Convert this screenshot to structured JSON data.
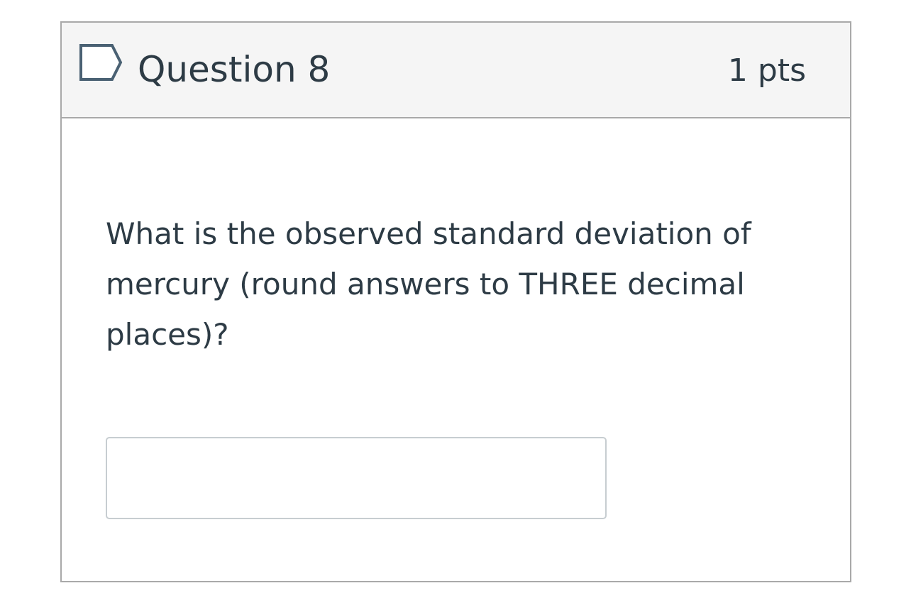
{
  "question": {
    "title": "Question 8",
    "points": "1 pts",
    "prompt": "What is the observed standard deviation of mercury (round answers to THREE decimal places)?",
    "answer": {
      "value": "",
      "placeholder": ""
    }
  },
  "icons": {
    "flag": "flag-question-icon"
  },
  "colors": {
    "header_background": "#f5f5f5",
    "border": "#a9a9a9",
    "text": "#2d3b45",
    "flag_stroke": "#4a6173",
    "input_border": "#c7cdd1"
  }
}
